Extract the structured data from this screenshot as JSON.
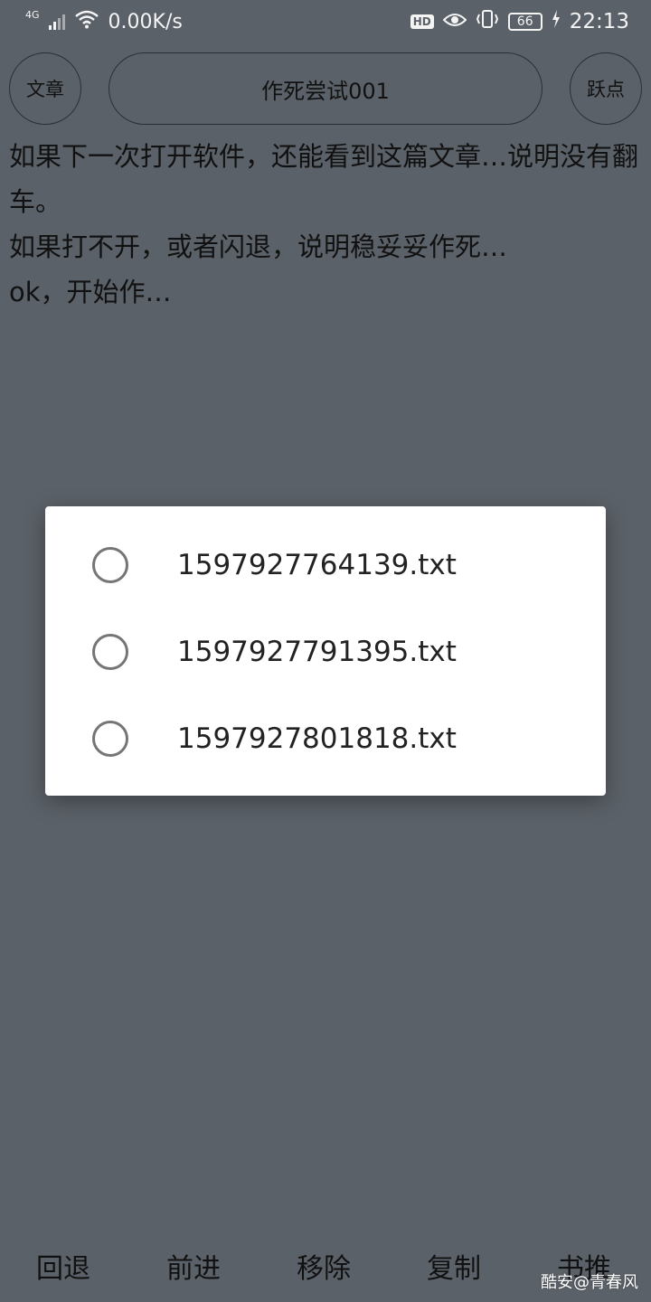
{
  "status_bar": {
    "network_type": "4G",
    "speed": "0.00K/s",
    "hd_label": "HD",
    "battery": "66",
    "time": "22:13",
    "icons": [
      "signal-icon",
      "wifi-icon",
      "eye-icon",
      "vibrate-icon",
      "battery-icon",
      "charging-icon"
    ]
  },
  "header": {
    "left_button": "文章",
    "title": "作死尝试001",
    "right_button": "跃点"
  },
  "article": {
    "paragraphs": [
      "如果下一次打开软件，还能看到这篇文章…说明没有翻车。",
      "如果打不开，或者闪退，说明稳妥妥作死…",
      "ok，开始作…"
    ]
  },
  "dialog": {
    "options": [
      {
        "label": "1597927764139.txt",
        "selected": false
      },
      {
        "label": "1597927791395.txt",
        "selected": false
      },
      {
        "label": "1597927801818.txt",
        "selected": false
      }
    ]
  },
  "toolbar": {
    "back": "回退",
    "forward": "前进",
    "remove": "移除",
    "copy": "复制",
    "bookmark": "书推"
  },
  "watermark": "酷安@青春风",
  "colors": {
    "background": "#5b6168",
    "dialog": "#ffffff",
    "radio_border": "#757575"
  }
}
